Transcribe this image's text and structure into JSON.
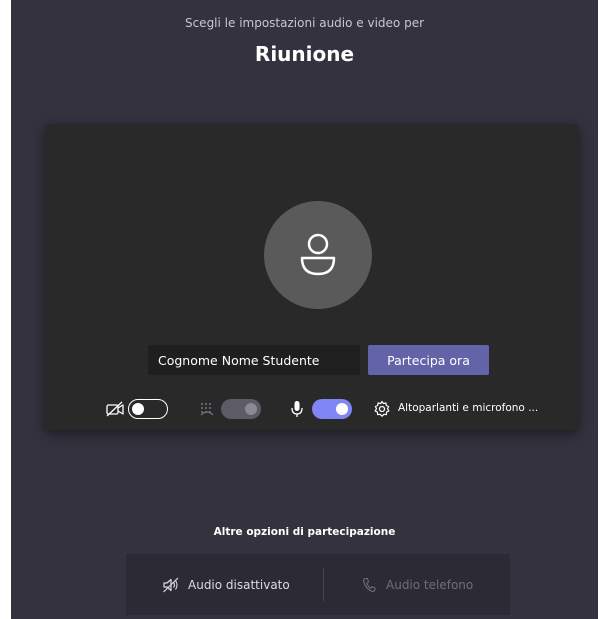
{
  "header": {
    "subtitle": "Scegli le impostazioni audio e video per",
    "title": "Riunione"
  },
  "preview": {
    "avatar_icon": "person-icon",
    "name_value": "Cognome Nome Studente",
    "join_label": "Partecipa ora"
  },
  "controls": {
    "video": {
      "icon": "camera-off-icon",
      "state": "off"
    },
    "background_blur": {
      "icon": "background-blur-icon",
      "state": "on"
    },
    "microphone": {
      "icon": "microphone-icon",
      "state": "on"
    },
    "devices": {
      "icon": "gear-icon",
      "label": "Altoparlanti e microfono ..."
    }
  },
  "other_options": {
    "heading": "Altre opzioni di partecipazione",
    "audio_off": {
      "icon": "speaker-off-icon",
      "label": "Audio disattivato"
    },
    "phone_audio": {
      "icon": "phone-icon",
      "label": "Audio telefono"
    }
  },
  "colors": {
    "background": "#33323e",
    "preview_bg": "#292929",
    "accent": "#6264a7",
    "toggle_on": "#7f85f5"
  }
}
